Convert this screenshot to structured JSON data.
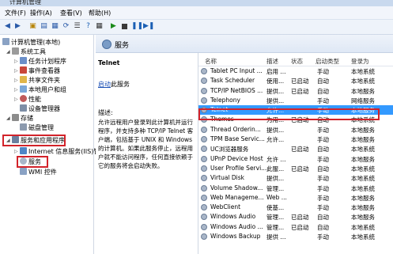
{
  "window": {
    "title": "计算机管理"
  },
  "menu": [
    "文件(F)",
    "操作(A)",
    "查看(V)",
    "帮助(H)"
  ],
  "tree": {
    "root": "计算机管理(本地)",
    "system_tools": "系统工具",
    "task_scheduler": "任务计划程序",
    "event_viewer": "事件查看器",
    "shared_folders": "共享文件夹",
    "local_users": "本地用户和组",
    "performance": "性能",
    "device_manager": "设备管理器",
    "storage": "存储",
    "disk_mgmt": "磁盘管理",
    "services_apps": "服务和应用程序",
    "iis": "Internet 信息服务(IIS)管",
    "services": "服务",
    "wmi": "WMI 控件"
  },
  "panel": {
    "title": "服务"
  },
  "detail": {
    "name": "Telnet",
    "start_link": "启动",
    "start_suffix": "此服务",
    "desc_label": "描述:",
    "desc_text": "允许远程用户登录到此计算机并运行程序，并支持多种 TCP/IP Telnet 客户端，包括基于 UNIX 和 Windows 的计算机。如果此服务停止，远程用户就不能访问程序，任何直接依赖于它的服务将会启动失败。"
  },
  "columns": {
    "name": "名称",
    "desc": "描述",
    "status": "状态",
    "startup": "启动类型",
    "logon": "登录为"
  },
  "services": [
    {
      "name": "Tablet PC Input ...",
      "desc": "启用 ...",
      "status": "",
      "startup": "手动",
      "logon": "本地系统"
    },
    {
      "name": "Task Scheduler",
      "desc": "使用...",
      "status": "已启动",
      "startup": "自动",
      "logon": "本地系统"
    },
    {
      "name": "TCP/IP NetBIOS ...",
      "desc": "提供...",
      "status": "已启动",
      "startup": "自动",
      "logon": "本地服务"
    },
    {
      "name": "Telephony",
      "desc": "提供...",
      "status": "",
      "startup": "手动",
      "logon": "网络服务"
    },
    {
      "name": "Telnet",
      "desc": "允许...",
      "status": "",
      "startup": "手动",
      "logon": "本地服务"
    },
    {
      "name": "Themes",
      "desc": "为用...",
      "status": "已启动",
      "startup": "自动",
      "logon": "本地系统"
    },
    {
      "name": "Thread Orderin...",
      "desc": "提供...",
      "status": "",
      "startup": "手动",
      "logon": "本地服务"
    },
    {
      "name": "TPM Base Servic...",
      "desc": "允许...",
      "status": "",
      "startup": "手动",
      "logon": "本地服务"
    },
    {
      "name": "UC浏览器服务",
      "desc": "",
      "status": "已启动",
      "startup": "自动",
      "logon": "本地系统"
    },
    {
      "name": "UPnP Device Host",
      "desc": "允许 ...",
      "status": "",
      "startup": "手动",
      "logon": "本地服务"
    },
    {
      "name": "User Profile Servi...",
      "desc": "此服...",
      "status": "已启动",
      "startup": "自动",
      "logon": "本地系统"
    },
    {
      "name": "Virtual Disk",
      "desc": "提供...",
      "status": "",
      "startup": "手动",
      "logon": "本地系统"
    },
    {
      "name": "Volume Shadow...",
      "desc": "管理...",
      "status": "",
      "startup": "手动",
      "logon": "本地系统"
    },
    {
      "name": "Web Manageme...",
      "desc": "Web ...",
      "status": "",
      "startup": "手动",
      "logon": "本地服务"
    },
    {
      "name": "WebClient",
      "desc": "使基...",
      "status": "",
      "startup": "手动",
      "logon": "本地服务"
    },
    {
      "name": "Windows Audio",
      "desc": "管理...",
      "status": "已启动",
      "startup": "自动",
      "logon": "本地服务"
    },
    {
      "name": "Windows Audio ...",
      "desc": "管理...",
      "status": "已启动",
      "startup": "自动",
      "logon": "本地系统"
    },
    {
      "name": "Windows Backup",
      "desc": "提供 ...",
      "status": "",
      "startup": "手动",
      "logon": "本地系统"
    }
  ]
}
